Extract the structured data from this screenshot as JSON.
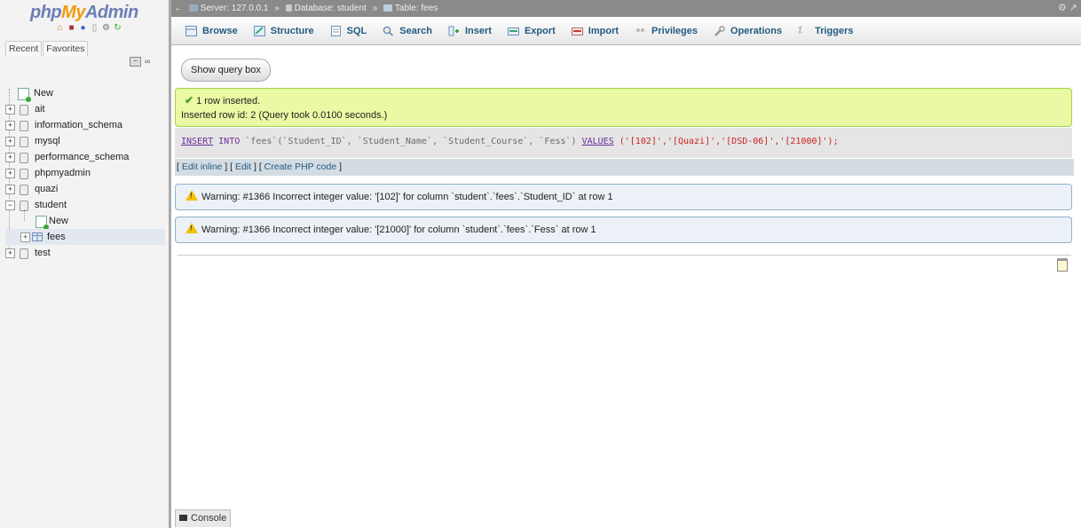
{
  "app": {
    "logo_php": "php",
    "logo_my": "My",
    "logo_admin": "Admin"
  },
  "nav": {
    "tabs": [
      "Recent",
      "Favorites"
    ],
    "tree": {
      "new_label": "New",
      "databases": [
        "ait",
        "information_schema",
        "mysql",
        "performance_schema",
        "phpmyadmin",
        "quazi",
        "student"
      ],
      "student_children": {
        "new_label": "New",
        "table": "fees"
      },
      "last_db": "test"
    }
  },
  "breadcrumb": {
    "server": "Server: 127.0.0.1",
    "database": "Database: student",
    "table": "Table: fees",
    "separator": "»"
  },
  "tabs": [
    "Browse",
    "Structure",
    "SQL",
    "Search",
    "Insert",
    "Export",
    "Import",
    "Privileges",
    "Operations",
    "Triggers"
  ],
  "main": {
    "show_query_button": "Show query box",
    "success": {
      "line1": "1 row inserted.",
      "line2": "Inserted row id: 2 (Query took 0.0100 seconds.)"
    },
    "sql": {
      "kw_insert": "INSERT",
      "kw_into": "INTO",
      "table": "`fees`",
      "columns": "(`Student_ID`, `Student_Name`, `Student_Course`, `Fess`)",
      "kw_values": "VALUES",
      "values": "('[102]','[Quazi]','[DSD-06]','[21000]');"
    },
    "links": {
      "edit_inline": "Edit inline",
      "edit": "Edit",
      "create_php": "Create PHP code"
    },
    "warnings": [
      "Warning: #1366 Incorrect integer value: '[102]' for column `student`.`fees`.`Student_ID` at row 1",
      "Warning: #1366 Incorrect integer value: '[21000]' for column `student`.`fees`.`Fess` at row 1"
    ],
    "console_label": "Console"
  },
  "colors": {
    "success_bg": "#ebf8a4",
    "warning_bg": "#ebf1f6",
    "tab_text": "#235a81",
    "logo_orange": "#f29c11"
  }
}
